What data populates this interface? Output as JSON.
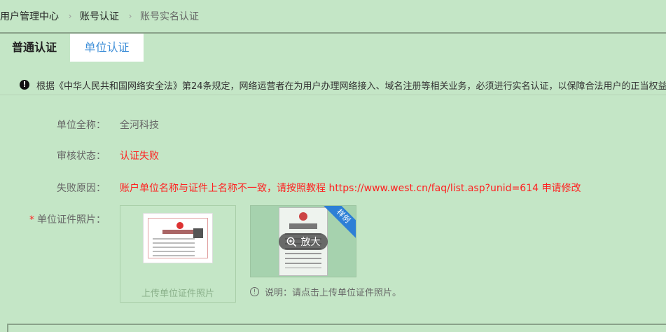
{
  "breadcrumb": {
    "items": [
      "用户管理中心",
      "账号认证",
      "账号实名认证"
    ],
    "separator_icon": "chevron-right-icon"
  },
  "tabs": [
    {
      "label": "普通认证",
      "active": false
    },
    {
      "label": "单位认证",
      "active": true
    }
  ],
  "notice": {
    "icon": "exclamation-circle-icon",
    "text": "根据《中华人民共和国网络安全法》第24条规定，网络运营者在为用户办理网络接入、域名注册等相关业务，必须进行实名认证，以保障合法用户的正当权益"
  },
  "form": {
    "company_name": {
      "label": "单位全称：",
      "value": "全河科技"
    },
    "review_status": {
      "label": "审核状态：",
      "value": "认证失败",
      "color": "#ff2020"
    },
    "fail_reason": {
      "label": "失败原因：",
      "value": "账户单位名称与证件上名称不一致，请按照教程 https://www.west.cn/faq/list.asp?unid=614 申请修改",
      "color": "#ff2020"
    },
    "certificate_photo": {
      "required_mark": "*",
      "label": "单位证件照片：",
      "upload_caption": "上传单位证件照片",
      "sample_badge": "样例",
      "zoom_label": "放大",
      "zoom_icon": "zoom-in-icon",
      "hint_icon": "info-circle-icon",
      "hint": "说明：请点击上传单位证件照片。"
    }
  },
  "colors": {
    "background": "#c4e6c6",
    "active_tab_text": "#3f8fd8",
    "error_text": "#ff2020",
    "ribbon": "#2d7fd6"
  }
}
